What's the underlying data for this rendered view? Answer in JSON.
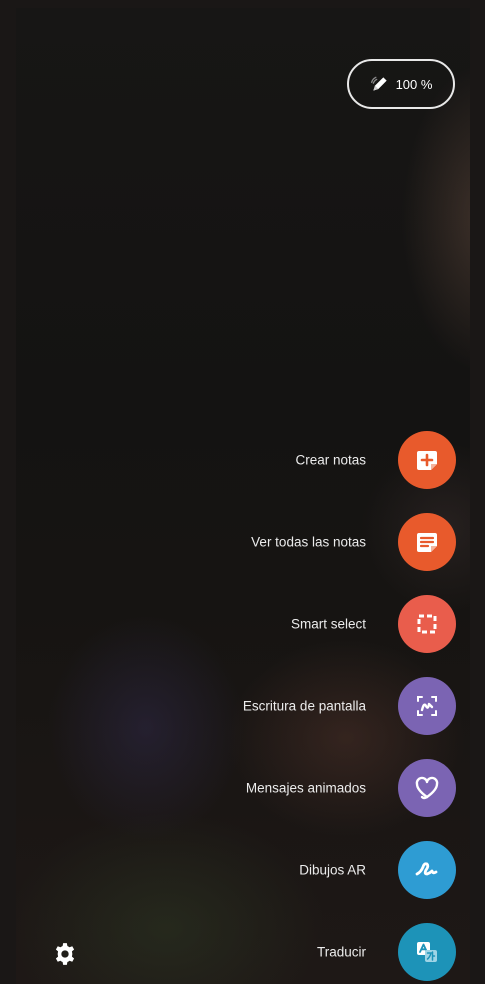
{
  "pen_status": {
    "battery": "100 %",
    "icon": "s-pen-icon"
  },
  "menu": {
    "items": [
      {
        "label": "Crear notas",
        "icon": "add-note-icon",
        "color": "#e85a2c"
      },
      {
        "label": "Ver todas las notas",
        "icon": "notes-list-icon",
        "color": "#e85a2c"
      },
      {
        "label": "Smart select",
        "icon": "smart-select-icon",
        "color": "#e95d4c"
      },
      {
        "label": "Escritura de pantalla",
        "icon": "screen-write-icon",
        "color": "#7b64b3"
      },
      {
        "label": "Mensajes animados",
        "icon": "heart-icon",
        "color": "#7b64b3"
      },
      {
        "label": "Dibujos AR",
        "icon": "ar-doodle-icon",
        "color": "#2e9cd3"
      },
      {
        "label": "Traducir",
        "icon": "translate-icon",
        "color": "#1d93b8"
      }
    ]
  },
  "settings": {
    "icon": "gear-icon"
  }
}
